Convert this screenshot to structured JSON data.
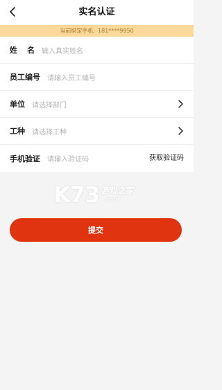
{
  "header": {
    "title": "实名认证",
    "back_icon": "chevron-left-icon"
  },
  "notice": {
    "label": "当前绑定手机:",
    "phone": "181****9950"
  },
  "form": {
    "name": {
      "label": "姓名",
      "placeholder": "输入真实姓名"
    },
    "employee_id": {
      "label": "员工编号",
      "placeholder": "请输入员工编号"
    },
    "department": {
      "label": "单位",
      "placeholder": "请选择部门"
    },
    "job_type": {
      "label": "工种",
      "placeholder": "请选择工种"
    },
    "phone_verify": {
      "label": "手机验证",
      "placeholder": "请输入验证码",
      "action": "获取验证码"
    }
  },
  "watermark": {
    "main": "K73",
    "sub": "游戏之家",
    "domain": ".com"
  },
  "submit": {
    "label": "提交"
  },
  "colors": {
    "accent": "#e0330f",
    "notice_bg": "#fbd99b",
    "notice_text": "#a97a2c"
  }
}
